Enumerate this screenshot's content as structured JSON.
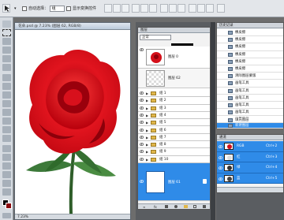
{
  "options_bar": {
    "auto_select_label": "自动选择：",
    "auto_select_value": "组",
    "show_transform_label": "显示变换控件"
  },
  "document": {
    "title": "花朵.psd @ 7.23% (图层 62, RGB/8)",
    "zoom": "7.23%"
  },
  "layers_panel": {
    "tab": "图层",
    "blend_mode": "正常",
    "layers": [
      {
        "name": "图层 0",
        "type": "layer"
      },
      {
        "name": "图层 62",
        "type": "layer"
      },
      {
        "name": "组 1",
        "type": "group"
      },
      {
        "name": "组 2",
        "type": "group"
      },
      {
        "name": "组 3",
        "type": "group"
      },
      {
        "name": "组 4",
        "type": "group"
      },
      {
        "name": "组 5",
        "type": "group"
      },
      {
        "name": "组 6",
        "type": "group"
      },
      {
        "name": "组 7",
        "type": "group"
      },
      {
        "name": "组 8",
        "type": "group"
      },
      {
        "name": "组 9",
        "type": "group"
      },
      {
        "name": "组 10",
        "type": "group"
      },
      {
        "name": "图层 61",
        "type": "layer"
      }
    ]
  },
  "history_panel": {
    "tab": "历史记录",
    "items": [
      "橡皮擦",
      "橡皮擦",
      "橡皮擦",
      "橡皮擦",
      "橡皮擦",
      "橡皮擦",
      "清除图层蒙版",
      "画笔工具",
      "画笔工具",
      "画笔工具",
      "画笔工具",
      "画笔工具",
      "画笔工具",
      "填充图层",
      "新建图层"
    ]
  },
  "channels_panel": {
    "tab": "通道",
    "channels": [
      {
        "name": "RGB",
        "shortcut": "Ctrl+2"
      },
      {
        "name": "红",
        "shortcut": "Ctrl+3"
      },
      {
        "name": "绿",
        "shortcut": "Ctrl+4"
      },
      {
        "name": "蓝",
        "shortcut": "Ctrl+5"
      }
    ]
  }
}
